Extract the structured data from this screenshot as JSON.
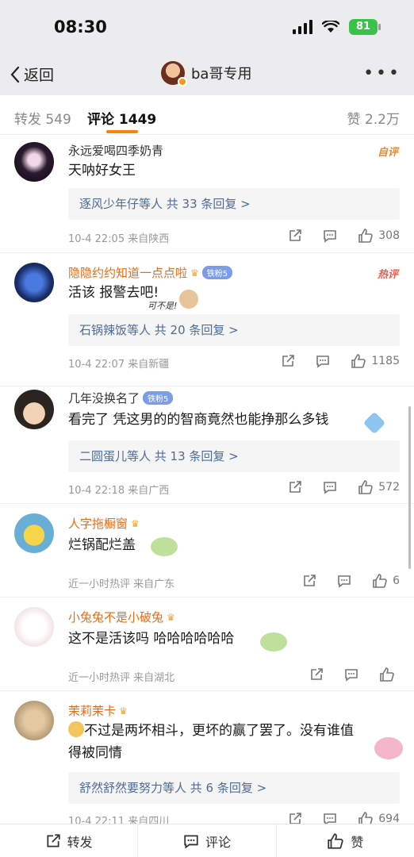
{
  "status": {
    "time": "08:30",
    "battery": "81"
  },
  "nav": {
    "back_label": "返回",
    "title": "ba哥专用"
  },
  "tabs": {
    "repost": "转发 549",
    "comment": "评论 1449",
    "like": "赞 2.2万"
  },
  "comments": [
    {
      "user": "永远爱喝四季奶青",
      "tag": "自评",
      "text": "天呐好女王",
      "reply_box": "逐风少年仔等人  共 33 条回复 >",
      "meta": "10-4 22:05  来自陕西",
      "likes": "308"
    },
    {
      "user": "隐隐约约知道一点点啦",
      "badge": "铁粉5",
      "tag": "热评",
      "text": "活该 报警去吧!",
      "sticker_text": "可不是!",
      "reply_box": "石锅辣饭等人  共 20 条回复 >",
      "meta": "10-4 22:07  来自新疆",
      "likes": "1185"
    },
    {
      "user": "几年没换名了",
      "badge": "铁粉5",
      "text": "看完了 凭这男的的智商竟然也能挣那么多钱",
      "reply_box": "二圆蛋儿等人  共 13 条回复 >",
      "meta": "10-4 22:18  来自广西",
      "likes": "572"
    },
    {
      "user": "人字拖橱窗",
      "text": "烂锅配烂盖",
      "meta": "近一小时热评  来自广东",
      "likes": "6"
    },
    {
      "user": "小兔兔不是小破兔",
      "text": "这不是活该吗  哈哈哈哈哈哈",
      "meta": "近一小时热评  来自湖北",
      "likes": ""
    },
    {
      "user": "茉莉茉卡",
      "text_line1": "不过是两坏相斗，更坏的赢了罢了。没有谁值",
      "text_line2": "得被同情",
      "reply_box": "舒然舒然要努力等人  共 6 条回复 >",
      "meta": "10-4 22:11  来自四川",
      "likes": "694"
    }
  ],
  "bottom": {
    "repost": "转发",
    "comment": "评论",
    "like": "赞"
  },
  "colors": {
    "accent": "#ff8200",
    "link": "#4f6b96",
    "hot": "#f25a4a",
    "username_orange": "#e86b17"
  }
}
